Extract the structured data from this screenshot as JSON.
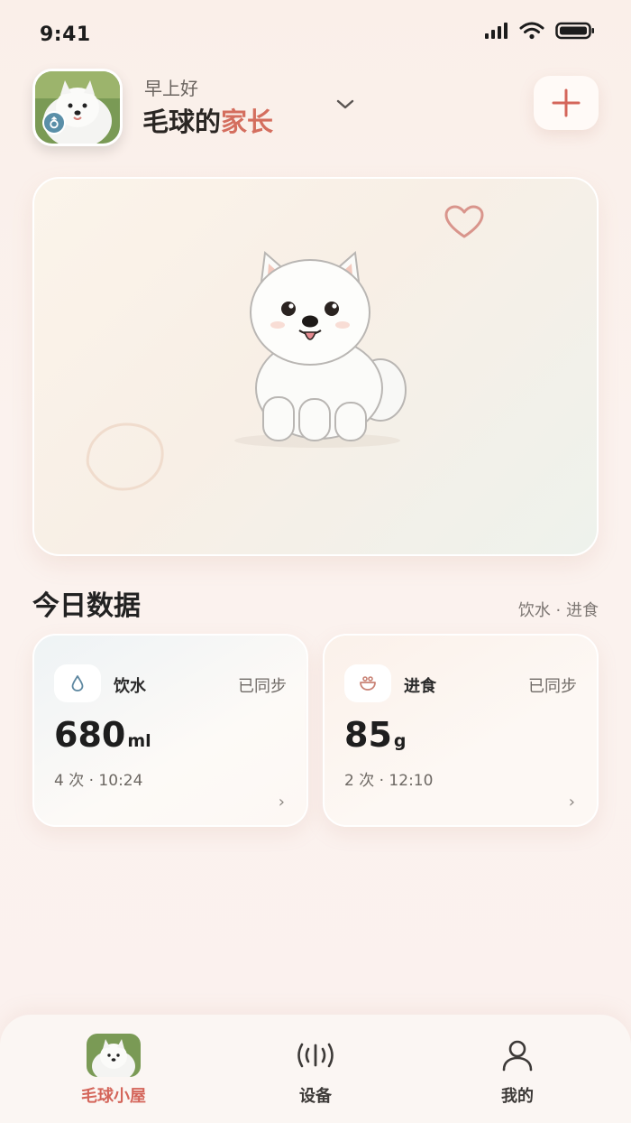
{
  "status_bar": {
    "time": "9:41"
  },
  "header": {
    "greeting": "早上好",
    "name_prefix": "毛球的",
    "name_accent": "家长"
  },
  "today": {
    "title": "今日数据",
    "subtitle": "饮水 · 进食"
  },
  "cards": [
    {
      "label": "饮水",
      "sync": "已同步",
      "value": "680",
      "unit": "ml",
      "meta": "4 次 · 10:24",
      "icon": "water-drop-icon"
    },
    {
      "label": "进食",
      "sync": "已同步",
      "value": "85",
      "unit": "g",
      "meta": "2 次 · 12:10",
      "icon": "food-bowl-icon"
    }
  ],
  "tabs": [
    {
      "label": "毛球小屋",
      "icon": "pet-avatar",
      "active": true
    },
    {
      "label": "设备",
      "icon": "device-signal-icon",
      "active": false
    },
    {
      "label": "我的",
      "icon": "user-icon",
      "active": false
    }
  ],
  "colors": {
    "accent": "#d46e5e",
    "background": "#fbf1ee"
  }
}
